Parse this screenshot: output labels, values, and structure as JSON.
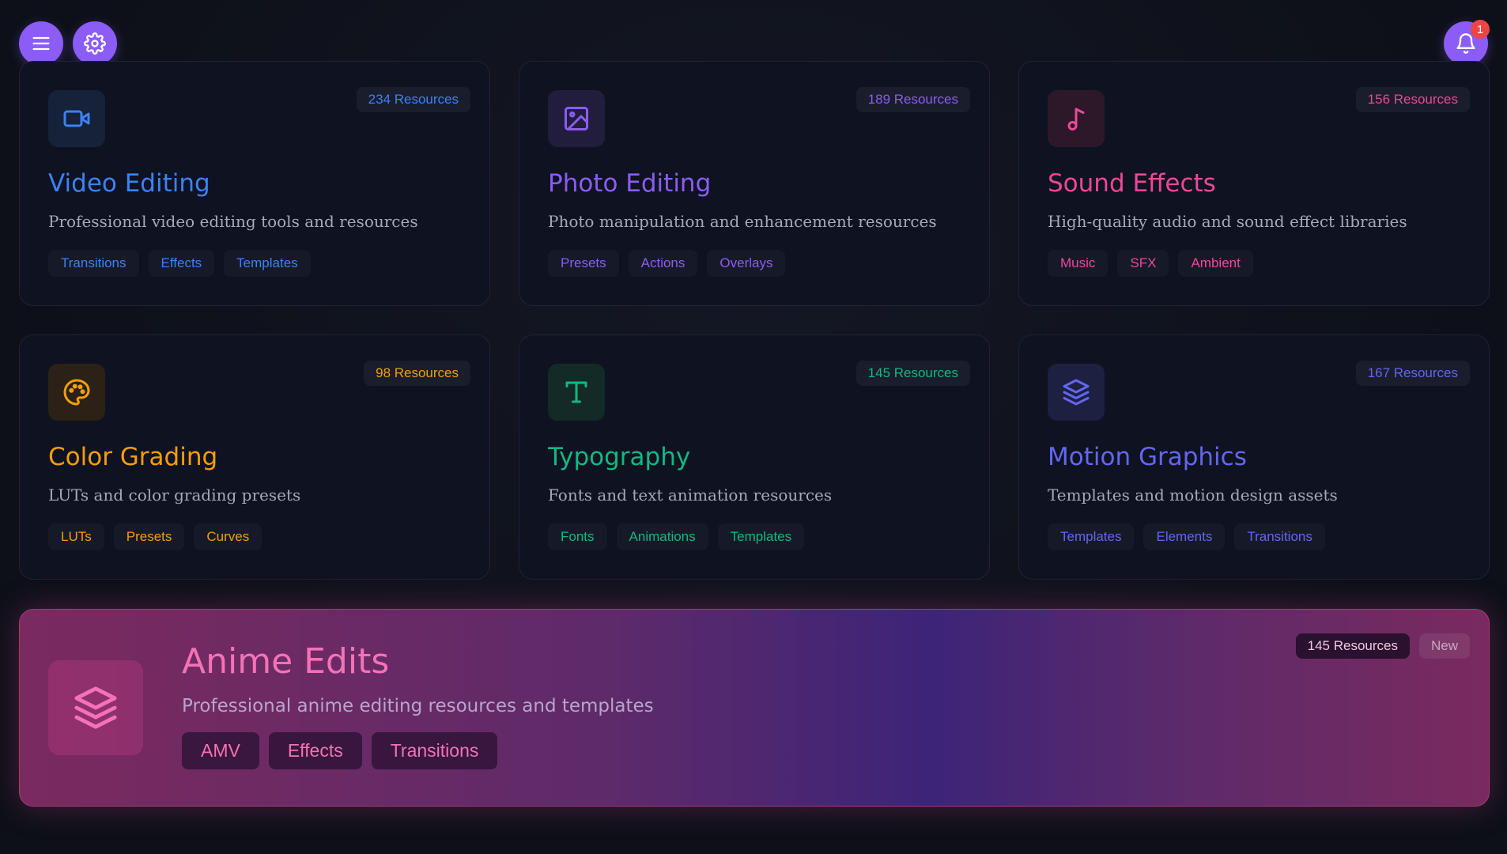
{
  "header": {
    "menu_icon": "menu-icon",
    "settings_icon": "gear-icon",
    "notifications": {
      "icon": "bell-icon",
      "count": "1"
    }
  },
  "cards": [
    {
      "icon": "video-camera-icon",
      "accent": "#3b82f6",
      "icon_bg": "#16213a",
      "resources": "234 Resources",
      "title": "Video Editing",
      "description": "Professional video editing tools and resources",
      "tags": [
        "Transitions",
        "Effects",
        "Templates"
      ]
    },
    {
      "icon": "image-icon",
      "accent": "#8b5cf6",
      "icon_bg": "#221d3c",
      "resources": "189 Resources",
      "title": "Photo Editing",
      "description": "Photo manipulation and enhancement resources",
      "tags": [
        "Presets",
        "Actions",
        "Overlays"
      ]
    },
    {
      "icon": "music-note-icon",
      "accent": "#ec4899",
      "icon_bg": "#2c1828",
      "resources": "156 Resources",
      "title": "Sound Effects",
      "description": "High-quality audio and sound effect libraries",
      "tags": [
        "Music",
        "SFX",
        "Ambient"
      ]
    },
    {
      "icon": "palette-icon",
      "accent": "#f59e0b",
      "icon_bg": "#2b2116",
      "resources": "98 Resources",
      "title": "Color Grading",
      "description": "LUTs and color grading presets",
      "tags": [
        "LUTs",
        "Presets",
        "Curves"
      ]
    },
    {
      "icon": "type-icon",
      "accent": "#10b981",
      "icon_bg": "#132a26",
      "resources": "145 Resources",
      "title": "Typography",
      "description": "Fonts and text animation resources",
      "tags": [
        "Fonts",
        "Animations",
        "Templates"
      ]
    },
    {
      "icon": "layers-icon",
      "accent": "#6366f1",
      "icon_bg": "#1d2040",
      "resources": "167 Resources",
      "title": "Motion Graphics",
      "description": "Templates and motion design assets",
      "tags": [
        "Templates",
        "Elements",
        "Transitions"
      ]
    }
  ],
  "featured": {
    "icon": "layers-icon",
    "accent": "#f472b6",
    "title": "Anime Edits",
    "description": "Professional anime editing resources and templates",
    "tags": [
      "AMV",
      "Effects",
      "Transitions"
    ],
    "resources": "145 Resources",
    "badge": "New"
  }
}
